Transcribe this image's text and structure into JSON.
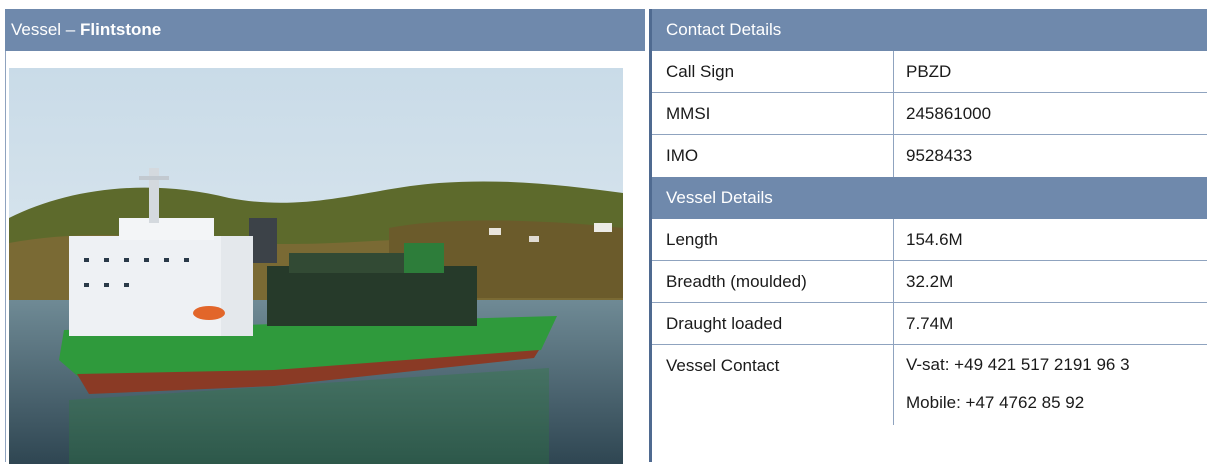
{
  "vessel_header": {
    "prefix": "Vessel – ",
    "name": "Flintstone"
  },
  "photo": {
    "icon": "ship-photo",
    "colors": {
      "sky": "#cfe0ec",
      "hull": "#2f9a3c",
      "water": "#3f5d6c",
      "shore": "#6e5a2e"
    }
  },
  "contact": {
    "title": "Contact Details",
    "rows": [
      {
        "label": "Call Sign",
        "value": "PBZD"
      },
      {
        "label": "MMSI",
        "value": "245861000"
      },
      {
        "label": "IMO",
        "value": "9528433"
      }
    ]
  },
  "vessel_details": {
    "title": "Vessel Details",
    "rows": [
      {
        "label": "Length",
        "value": "154.6M"
      },
      {
        "label": "Breadth (moulded)",
        "value": "32.2M"
      },
      {
        "label": "Draught loaded",
        "value": "7.74M"
      }
    ],
    "contact_row": {
      "label": "Vessel Contact",
      "values": [
        "V-sat: +49 421 517 2191 96 3",
        "Mobile: +47 4762 85 92"
      ]
    }
  },
  "colors": {
    "header_bg": "#6f89ac",
    "divider": "#4f6a90",
    "border": "#8fa3bf"
  }
}
